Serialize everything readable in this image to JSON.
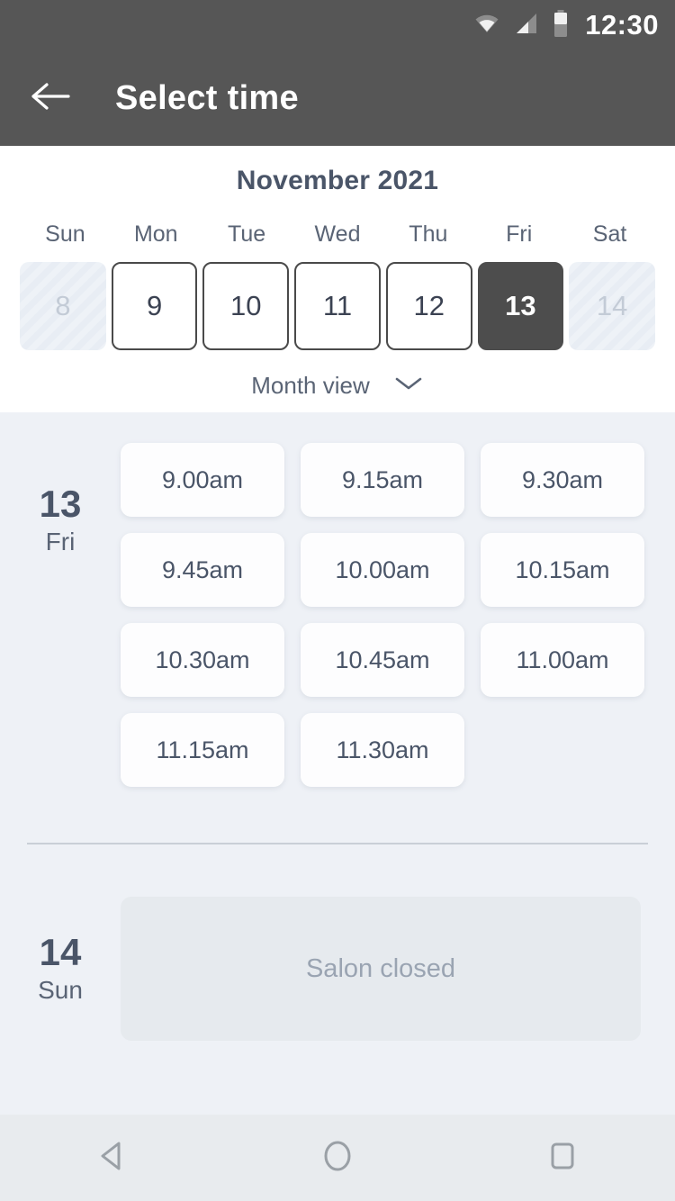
{
  "statusbar": {
    "time": "12:30",
    "icons": [
      "wifi-icon",
      "signal-icon",
      "battery-icon"
    ]
  },
  "appbar": {
    "back_icon": "back-arrow-icon",
    "title": "Select time"
  },
  "calendar": {
    "month_label": "November 2021",
    "weekdays": [
      "Sun",
      "Mon",
      "Tue",
      "Wed",
      "Thu",
      "Fri",
      "Sat"
    ],
    "days": [
      {
        "num": "8",
        "state": "disabled"
      },
      {
        "num": "9",
        "state": "available"
      },
      {
        "num": "10",
        "state": "available"
      },
      {
        "num": "11",
        "state": "available"
      },
      {
        "num": "12",
        "state": "available"
      },
      {
        "num": "13",
        "state": "selected"
      },
      {
        "num": "14",
        "state": "disabled"
      }
    ],
    "view_toggle": {
      "label": "Month view",
      "icon": "chevron-down-icon"
    }
  },
  "schedule": [
    {
      "day_num": "13",
      "day_of_week": "Fri",
      "slots": [
        "9.00am",
        "9.15am",
        "9.30am",
        "9.45am",
        "10.00am",
        "10.15am",
        "10.30am",
        "10.45am",
        "11.00am",
        "11.15am",
        "11.30am"
      ]
    },
    {
      "day_num": "14",
      "day_of_week": "Sun",
      "closed_message": "Salon closed"
    }
  ],
  "navbar": {
    "back": "nav-back-icon",
    "home": "nav-home-icon",
    "recents": "nav-recents-icon"
  },
  "colors": {
    "appbar_bg": "#565656",
    "selected_day_bg": "#4d4d4d",
    "page_bg": "#eef1f6",
    "text_primary": "#4a5568",
    "text_muted": "#9aa4b2"
  }
}
